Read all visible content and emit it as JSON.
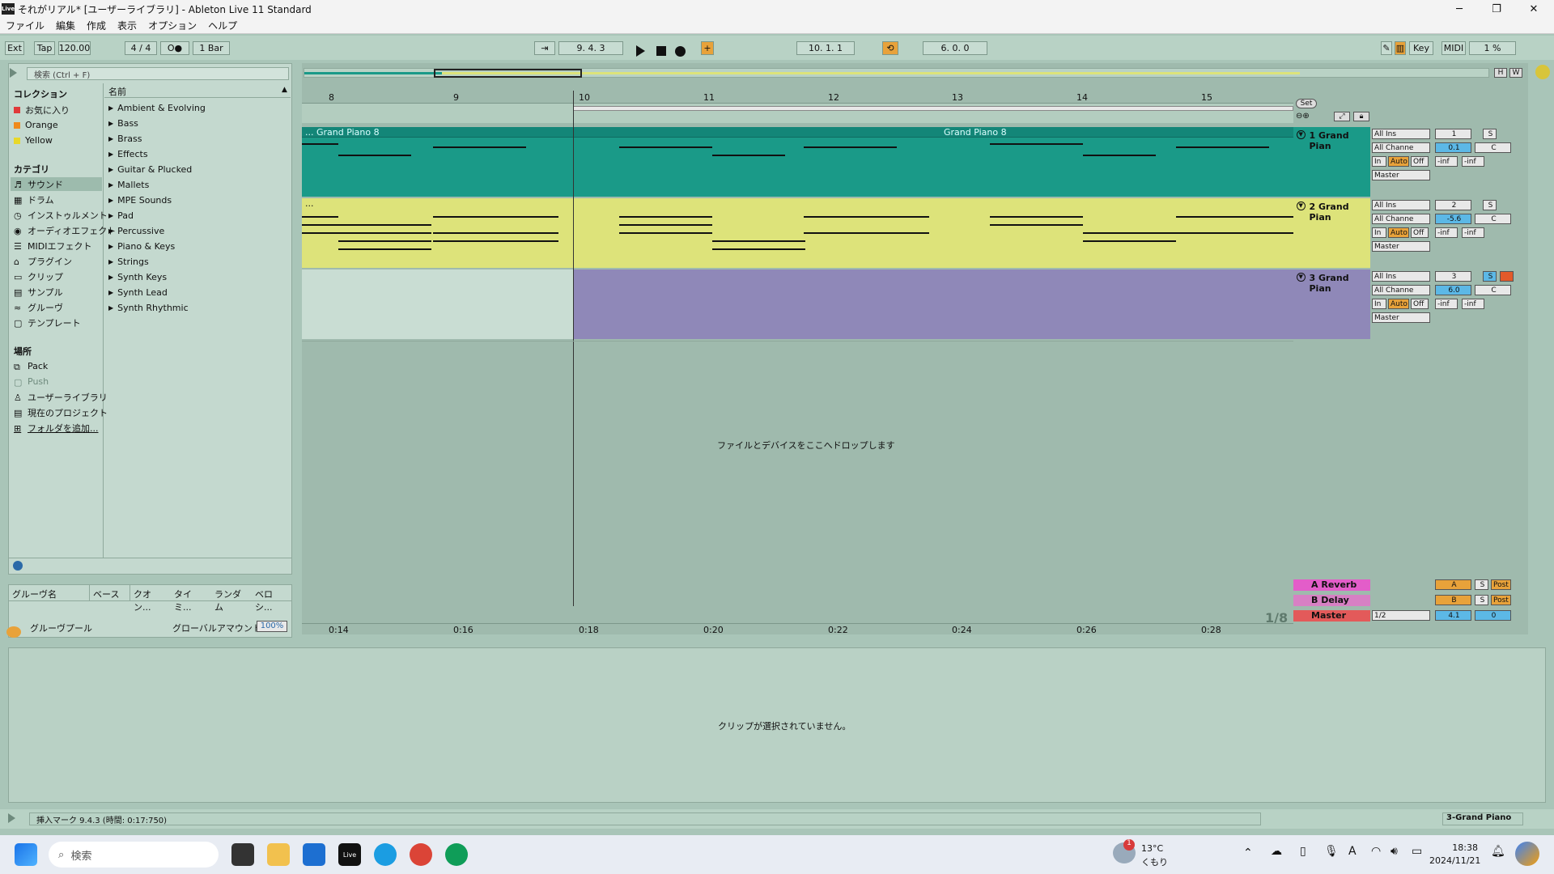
{
  "window": {
    "title": "それがリアル* [ユーザーライブラリ] - Ableton Live 11 Standard",
    "logo": "Live"
  },
  "menu": [
    "ファイル",
    "編集",
    "作成",
    "表示",
    "オプション",
    "ヘルプ"
  ],
  "control": {
    "ext": "Ext",
    "tap": "Tap",
    "tempo": "120.00",
    "sig": "4 / 4",
    "metro": "O●",
    "quant": "1 Bar",
    "pos": "9.  4.  3",
    "loop_start": "10.  1.  1",
    "loop_len": "6.  0.  0",
    "key": "Key",
    "midi": "MIDI",
    "cpu": "1 %"
  },
  "browser": {
    "search": "検索 (Ctrl + F)",
    "collections_title": "コレクション",
    "collections": [
      {
        "label": "お気に入り",
        "color": "#e03a3a"
      },
      {
        "label": "Orange",
        "color": "#f08a1c"
      },
      {
        "label": "Yellow",
        "color": "#e8d829"
      }
    ],
    "categories_title": "カテゴリ",
    "categories": [
      "サウンド",
      "ドラム",
      "インストゥルメント",
      "オーディオエフェクト",
      "MIDIエフェクト",
      "プラグイン",
      "クリップ",
      "サンプル",
      "グルーヴ",
      "テンプレート"
    ],
    "places_title": "場所",
    "places": [
      "Pack",
      "Push",
      "ユーザーライブラリ",
      "現在のプロジェクト",
      "フォルダを追加..."
    ],
    "name_header": "名前",
    "names": [
      "Ambient & Evolving",
      "Bass",
      "Brass",
      "Effects",
      "Guitar & Plucked",
      "Mallets",
      "MPE Sounds",
      "Pad",
      "Percussive",
      "Piano & Keys",
      "Strings",
      "Synth Keys",
      "Synth Lead",
      "Synth Rhythmic"
    ],
    "groove_headers": [
      "グルーヴ名",
      "ベース",
      "クオン...",
      "タイミ...",
      "ランダム",
      "ベロシ..."
    ],
    "groove_pool": "グルーヴプール",
    "global_amount": "グローバルアマウント",
    "global_value": "100%"
  },
  "arrangement": {
    "bars": [
      "8",
      "9",
      "10",
      "11",
      "12",
      "13",
      "14",
      "15"
    ],
    "times": [
      "0:14",
      "0:16",
      "0:18",
      "0:20",
      "0:22",
      "0:24",
      "0:26",
      "0:28"
    ],
    "set": "Set",
    "clip1_a": "... Grand Piano 8",
    "clip1_b": "Grand Piano 8",
    "clip2": "...",
    "drop": "ファイルとデバイスをここへドロップします",
    "zoom": "1/8",
    "tracks": [
      {
        "name": "1 Grand Pian",
        "num": "1",
        "vol": "0.1",
        "pan": "C",
        "color": "#1a9a88"
      },
      {
        "name": "2 Grand Pian",
        "num": "2",
        "vol": "-5.6",
        "pan": "C",
        "color": "#dde37a"
      },
      {
        "name": "3 Grand Pian",
        "num": "3",
        "vol": "6.0",
        "pan": "C",
        "color": "#8f88b8"
      }
    ],
    "returns": [
      {
        "name": "A Reverb",
        "send": "A",
        "color": "#e35dc9"
      },
      {
        "name": "B Delay",
        "send": "B",
        "color": "#d780c4"
      },
      {
        "name": "Master",
        "send": "",
        "color": "#e35a5a"
      }
    ],
    "mix": {
      "in": "All Ins",
      "ch": "All Channe",
      "inbtn": "In",
      "auto": "Auto",
      "off": "Off",
      "out": "Master",
      "inf": "-inf",
      "s": "S",
      "post": "Post",
      "cue": "1/2",
      "master_vol": "4.1",
      "master_pan": "0"
    }
  },
  "detail": {
    "empty": "クリップが選択されていません。"
  },
  "status": {
    "text": "挿入マーク 9.4.3 (時間: 0:17:750)",
    "track": "3-Grand Piano"
  },
  "taskbar": {
    "search": "検索",
    "temp": "13°C",
    "weather": "くもり",
    "time": "18:38",
    "date": "2024/11/21",
    "badge": "1"
  }
}
